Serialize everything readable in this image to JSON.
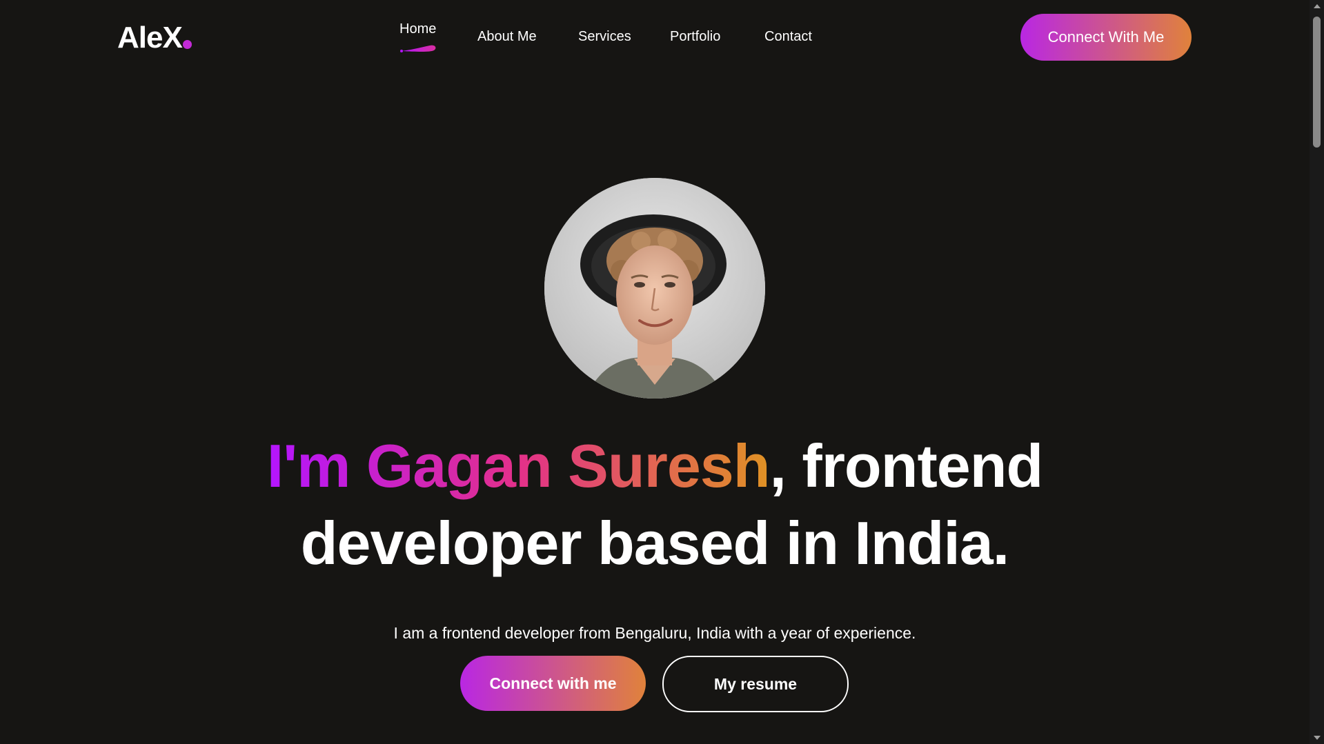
{
  "navbar": {
    "logo": "AleX",
    "menu": [
      {
        "label": "Home",
        "active": true
      },
      {
        "label": "About Me"
      },
      {
        "label": "Services"
      },
      {
        "label": "Portfolio"
      },
      {
        "label": "Contact"
      }
    ],
    "connect_label": "Connect With Me"
  },
  "hero": {
    "avatar_alt": "",
    "title_name": "I'm Gagan Suresh",
    "title_rest_line1": ", frontend",
    "title_line2": "developer based in India.",
    "description": "I am a frontend developer from Bengaluru, India with a year of experience.",
    "primary_button": "Connect with me",
    "secondary_button": "My resume"
  },
  "colors": {
    "background": "#161513",
    "gradient_start": "#b415ff",
    "gradient_mid": "#e3308a",
    "gradient_end": "#e09224",
    "text": "#ffffff"
  },
  "icons": {
    "scroll_up": "triangle-up-icon",
    "scroll_down": "triangle-down-icon",
    "nav_active_marker": "swoosh-underline-icon"
  }
}
